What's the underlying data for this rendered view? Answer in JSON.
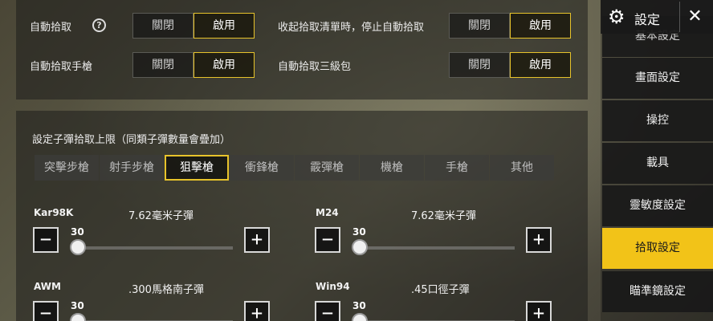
{
  "toggles": {
    "off_label": "關閉",
    "on_label": "啟用",
    "auto_pickup": "自動拾取",
    "auto_pickup_pistol": "自動拾取手槍",
    "stop_on_collapse": "收起拾取清單時，停止自動拾取",
    "auto_pickup_lvl3_backpack": "自動拾取三級包",
    "help_glyph": "?"
  },
  "ammo_section": {
    "title": "設定子彈拾取上限（同類子彈數量會疊加）",
    "tabs": [
      "突擊步槍",
      "射手步槍",
      "狙擊槍",
      "衝鋒槍",
      "霰彈槍",
      "機槍",
      "手槍",
      "其他"
    ],
    "active_tab": "狙擊槍",
    "weapons": [
      {
        "name": "Kar98K",
        "ammo": "7.62毫米子彈",
        "value": "30"
      },
      {
        "name": "M24",
        "ammo": "7.62毫米子彈",
        "value": "30"
      },
      {
        "name": "AWM",
        "ammo": ".300馬格南子彈",
        "value": "30"
      },
      {
        "name": "Win94",
        "ammo": ".45口徑子彈",
        "value": "30"
      }
    ],
    "minus": "−",
    "plus": "+"
  },
  "sidebar": {
    "title": "設定",
    "close_glyph": "✕",
    "gear_glyph": "⚙",
    "items": [
      "基本設定",
      "畫面設定",
      "操控",
      "載具",
      "靈敏度設定",
      "拾取設定",
      "瞄準鏡設定"
    ],
    "active_item": "拾取設定"
  }
}
